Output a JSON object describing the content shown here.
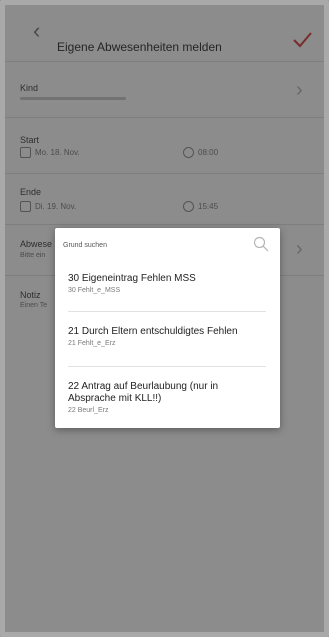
{
  "header": {
    "title": "Eigene Abwesenheiten melden"
  },
  "form": {
    "kind_label": "Kind",
    "start_label": "Start",
    "start_date": "Mo. 18. Nov.",
    "start_time": "08:00",
    "ende_label": "Ende",
    "ende_date": "Di. 19. Nov.",
    "ende_time": "15:45",
    "abwesenheit_label": "Abwese",
    "abwesenheit_sub": "Bitte ein",
    "notiz_label": "Notiz",
    "notiz_sub": "Einen Te"
  },
  "dialog": {
    "search_placeholder": "Grund suchen",
    "items": [
      {
        "title": "30 Eigeneintrag Fehlen MSS",
        "code": "30 Fehlt_e_MSS"
      },
      {
        "title": "21 Durch Eltern entschuldigtes Fehlen",
        "code": "21 Fehlt_e_Erz"
      },
      {
        "title": "22 Antrag auf Beurlaubung (nur in Absprache mit KLL!!)",
        "code": "22 Beurl_Erz"
      }
    ]
  },
  "colors": {
    "accent": "#d9534f",
    "scrim": "#000000"
  }
}
